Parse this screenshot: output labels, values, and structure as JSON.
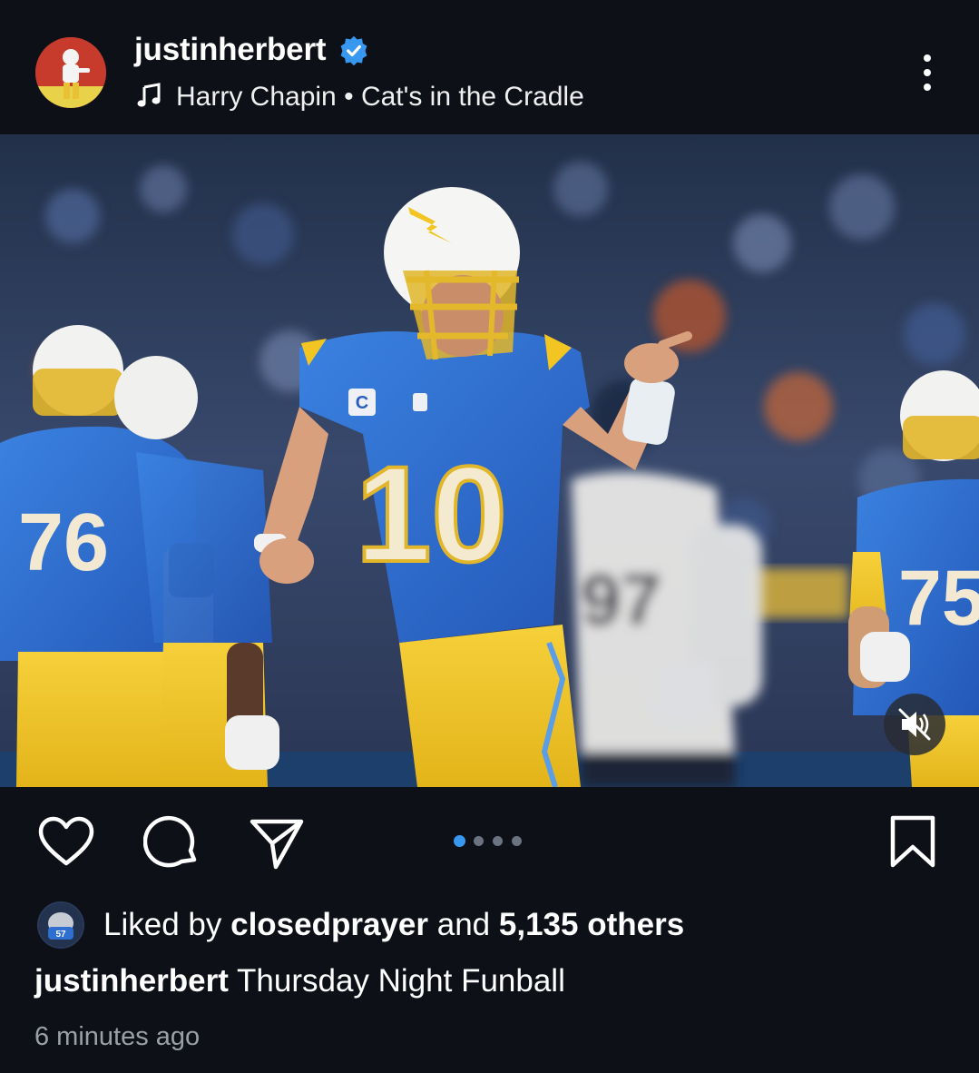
{
  "post": {
    "username": "justinherbert",
    "music": {
      "artist": "Harry Chapin",
      "separator": "•",
      "song": "Cat's in the Cradle"
    },
    "carousel": {
      "count": 4,
      "active_index": 0
    },
    "likes": {
      "prefix": "Liked by",
      "liker": "closedprayer",
      "and_text": "and",
      "others": "5,135 others"
    },
    "caption": {
      "username": "justinherbert",
      "text": "Thursday Night Funball"
    },
    "timestamp": "6 minutes ago"
  },
  "icons": {
    "verified": "verified-badge-icon",
    "music": "music-note-icon",
    "more": "more-options-icon",
    "like": "heart-icon",
    "comment": "comment-icon",
    "share": "send-icon",
    "save": "bookmark-icon",
    "mute": "muted-speaker-icon"
  },
  "colors": {
    "background": "#0d1117",
    "verified": "#3897f0",
    "active_dot": "#3897f0",
    "inactive_dot": "#6b7280",
    "timestamp": "#9aa0a6",
    "jersey_blue": "#2f6fd1",
    "pants_gold": "#f2c523"
  }
}
